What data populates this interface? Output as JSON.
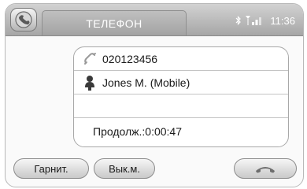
{
  "header": {
    "title": "ТЕЛЕФОН",
    "time": "11:36",
    "icons": [
      "bluetooth-icon",
      "signal-strength-icon"
    ]
  },
  "home_button": {
    "icon": "home-phone-icon"
  },
  "call": {
    "number": "020123456",
    "number_icon": "phone-handset-icon",
    "contact": "Jones M. (Mobile)",
    "contact_icon": "contact-person-icon",
    "duration_text": "Продолж.:0:00:47"
  },
  "buttons": {
    "headset": "Гарнит.",
    "mute": "Вык.м.",
    "end_call_icon": "hang-up-icon"
  },
  "colors": {
    "header": "#a6a6a6",
    "button_bg": "#e0e0e0",
    "text": "#1a1a1a"
  }
}
